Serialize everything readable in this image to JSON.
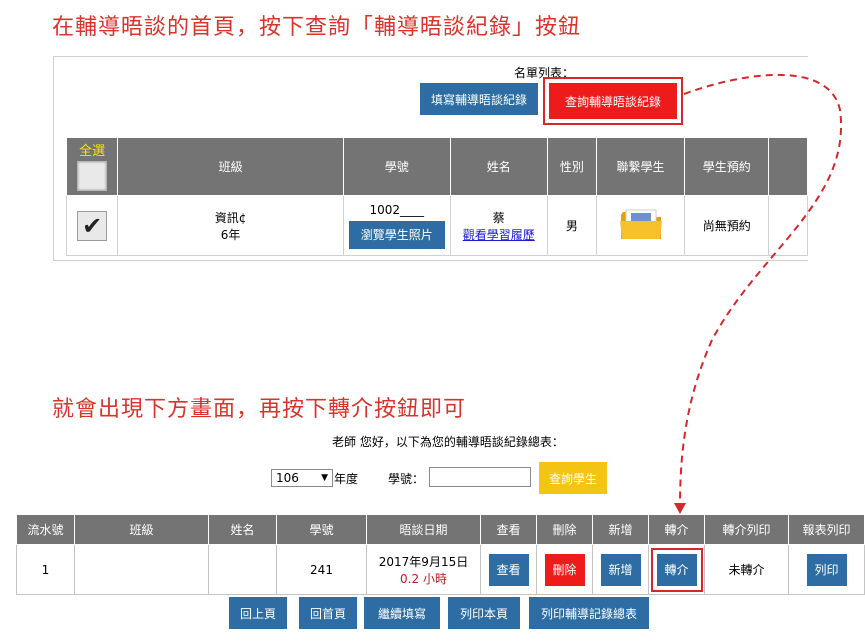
{
  "instructions": {
    "step1": "在輔導晤談的首頁，按下查詢「輔導晤談紀錄」按鈕",
    "step2": "就會出現下方畫面，再按下轉介按鈕即可"
  },
  "list_panel": {
    "title": "名單列表：",
    "fill_button": "填寫輔導晤談紀錄",
    "query_button": "查詢輔導晤談紀錄",
    "columns": [
      "全選",
      "班級",
      "學號",
      "姓名",
      "性別",
      "聯繫學生",
      "學生預約"
    ],
    "row": {
      "class_name": "資訊¢",
      "grade": "6年",
      "student_id": "1002____",
      "photo_button": "瀏覽學生照片",
      "name": "蔡",
      "history_link": "觀看學習履歷",
      "gender": "男",
      "contact_icon": "folder-icon",
      "reservation": "尚無預約"
    }
  },
  "records": {
    "teacher_line": "老師 您好，以下為您的輔導晤談紀錄總表：",
    "year_value": "106",
    "year_label": "年度",
    "student_id_label": "學號：",
    "student_id_value": "",
    "query_student_button": "查詢學生",
    "columns": [
      "流水號",
      "班級",
      "姓名",
      "學號",
      "晤談日期",
      "查看",
      "刪除",
      "新增",
      "轉介",
      "轉介列印",
      "報表列印"
    ],
    "row": {
      "serial": "1",
      "class_name": "",
      "name": "",
      "student_id": "241",
      "date": "2017年9月15日",
      "hours": "0.2 小時",
      "view_button": "查看",
      "delete_button": "刪除",
      "add_button": "新增",
      "transfer_button": "轉介",
      "transfer_print": "未轉介",
      "print_button": "列印"
    },
    "nav": {
      "back": "回上頁",
      "home": "回首頁",
      "continue": "繼續填寫",
      "print_page": "列印本頁",
      "print_summary": "列印輔導記錄總表"
    }
  },
  "colors": {
    "accent_red": "#d8262a",
    "button_blue": "#2d6da3",
    "button_red": "#ee1b1b",
    "button_yellow": "#f3c413",
    "header_gray": "#747474"
  }
}
